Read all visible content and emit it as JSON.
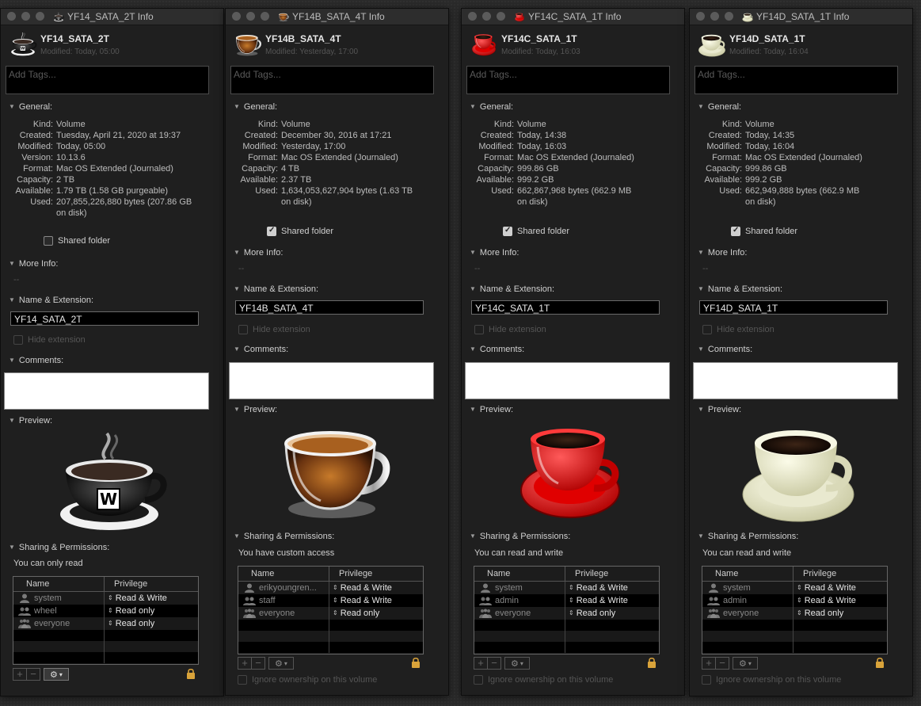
{
  "colors": {
    "window_bg": "#1f1f1f",
    "titlebar": "#2d2d2d",
    "lock_gold": "#d9a33a",
    "check_on": "#cfcfcf"
  },
  "windows": [
    {
      "title": "YF14_SATA_2T Info",
      "name": "YF14_SATA_2T",
      "modified": "Modified: Today, 05:00",
      "icon": "black-coffee-cup-w-icon",
      "tags_placeholder": "Add Tags...",
      "general_label": "General:",
      "general": [
        {
          "k": "Kind:",
          "v": "Volume"
        },
        {
          "k": "Created:",
          "v": "Tuesday, April 21, 2020 at 19:37"
        },
        {
          "k": "Modified:",
          "v": "Today, 05:00"
        },
        {
          "k": "Version:",
          "v": "10.13.6"
        },
        {
          "k": "Format:",
          "v": "Mac OS Extended (Journaled)"
        },
        {
          "k": "Capacity:",
          "v": "2 TB"
        },
        {
          "k": "Available:",
          "v": "1.79 TB (1.58 GB purgeable)"
        },
        {
          "k": "Used:",
          "v": "207,855,226,880 bytes (207.86 GB"
        },
        {
          "k": "",
          "v": "on disk)"
        }
      ],
      "shared_folder": "Shared folder",
      "shared_checked": false,
      "more_info": "More Info:",
      "more_info_value": "--",
      "name_ext": "Name & Extension:",
      "name_value": "YF14_SATA_2T",
      "hide_extension": "Hide extension",
      "comments": "Comments:",
      "preview": "Preview:",
      "sharing": "Sharing & Permissions:",
      "access": "You can only read",
      "col_name": "Name",
      "col_priv": "Privilege",
      "perms": [
        {
          "name": "system",
          "priv": "Read & Write",
          "icon": "user-icon"
        },
        {
          "name": "wheel",
          "priv": "Read only",
          "icon": "group-icon"
        },
        {
          "name": "everyone",
          "priv": "Read only",
          "icon": "everyone-icon"
        }
      ],
      "ignore": ""
    },
    {
      "title": "YF14B_SATA_4T Info",
      "name": "YF14B_SATA_4T",
      "modified": "Modified: Yesterday, 17:00",
      "icon": "glass-espresso-cup-icon",
      "tags_placeholder": "Add Tags...",
      "general_label": "General:",
      "general": [
        {
          "k": "Kind:",
          "v": "Volume"
        },
        {
          "k": "Created:",
          "v": "December 30, 2016 at 17:21"
        },
        {
          "k": "Modified:",
          "v": "Yesterday, 17:00"
        },
        {
          "k": "Format:",
          "v": "Mac OS Extended (Journaled)"
        },
        {
          "k": "Capacity:",
          "v": "4 TB"
        },
        {
          "k": "Available:",
          "v": "2.37 TB"
        },
        {
          "k": "Used:",
          "v": "1,634,053,627,904 bytes (1.63 TB"
        },
        {
          "k": "",
          "v": "on disk)"
        }
      ],
      "shared_folder": "Shared folder",
      "shared_checked": true,
      "more_info": "More Info:",
      "more_info_value": "--",
      "name_ext": "Name & Extension:",
      "name_value": "YF14B_SATA_4T",
      "hide_extension": "Hide extension",
      "comments": "Comments:",
      "preview": "Preview:",
      "sharing": "Sharing & Permissions:",
      "access": "You have custom access",
      "col_name": "Name",
      "col_priv": "Privilege",
      "perms": [
        {
          "name": "erikyoungren...",
          "priv": "Read & Write",
          "icon": "user-icon"
        },
        {
          "name": "staff",
          "priv": "Read & Write",
          "icon": "group-icon"
        },
        {
          "name": "everyone",
          "priv": "Read only",
          "icon": "everyone-icon"
        }
      ],
      "ignore": "Ignore ownership on this volume"
    },
    {
      "title": "YF14C_SATA_1T Info",
      "name": "YF14C_SATA_1T",
      "modified": "Modified: Today, 16:03",
      "icon": "red-coffee-cup-icon",
      "tags_placeholder": "Add Tags...",
      "general_label": "General:",
      "general": [
        {
          "k": "Kind:",
          "v": "Volume"
        },
        {
          "k": "Created:",
          "v": "Today, 14:38"
        },
        {
          "k": "Modified:",
          "v": "Today, 16:03"
        },
        {
          "k": "Format:",
          "v": "Mac OS Extended (Journaled)"
        },
        {
          "k": "Capacity:",
          "v": "999.86 GB"
        },
        {
          "k": "Available:",
          "v": "999.2 GB"
        },
        {
          "k": "Used:",
          "v": "662,867,968 bytes (662.9 MB"
        },
        {
          "k": "",
          "v": "on disk)"
        }
      ],
      "shared_folder": "Shared folder",
      "shared_checked": true,
      "more_info": "More Info:",
      "more_info_value": "--",
      "name_ext": "Name & Extension:",
      "name_value": "YF14C_SATA_1T",
      "hide_extension": "Hide extension",
      "comments": "Comments:",
      "preview": "Preview:",
      "sharing": "Sharing & Permissions:",
      "access": "You can read and write",
      "col_name": "Name",
      "col_priv": "Privilege",
      "perms": [
        {
          "name": "system",
          "priv": "Read & Write",
          "icon": "user-icon"
        },
        {
          "name": "admin",
          "priv": "Read & Write",
          "icon": "group-icon"
        },
        {
          "name": "everyone",
          "priv": "Read only",
          "icon": "everyone-icon"
        }
      ],
      "ignore": "Ignore ownership on this volume"
    },
    {
      "title": "YF14D_SATA_1T Info",
      "name": "YF14D_SATA_1T",
      "modified": "Modified: Today, 16:04",
      "icon": "cream-coffee-cup-icon",
      "tags_placeholder": "Add Tags...",
      "general_label": "General:",
      "general": [
        {
          "k": "Kind:",
          "v": "Volume"
        },
        {
          "k": "Created:",
          "v": "Today, 14:35"
        },
        {
          "k": "Modified:",
          "v": "Today, 16:04"
        },
        {
          "k": "Format:",
          "v": "Mac OS Extended (Journaled)"
        },
        {
          "k": "Capacity:",
          "v": "999.86 GB"
        },
        {
          "k": "Available:",
          "v": "999.2 GB"
        },
        {
          "k": "Used:",
          "v": "662,949,888 bytes (662.9 MB"
        },
        {
          "k": "",
          "v": "on disk)"
        }
      ],
      "shared_folder": "Shared folder",
      "shared_checked": true,
      "more_info": "More Info:",
      "more_info_value": "--",
      "name_ext": "Name & Extension:",
      "name_value": "YF14D_SATA_1T",
      "hide_extension": "Hide extension",
      "comments": "Comments:",
      "preview": "Preview:",
      "sharing": "Sharing & Permissions:",
      "access": "You can read and write",
      "col_name": "Name",
      "col_priv": "Privilege",
      "perms": [
        {
          "name": "system",
          "priv": "Read & Write",
          "icon": "user-icon"
        },
        {
          "name": "admin",
          "priv": "Read & Write",
          "icon": "group-icon"
        },
        {
          "name": "everyone",
          "priv": "Read only",
          "icon": "everyone-icon"
        }
      ],
      "ignore": "Ignore ownership on this volume"
    }
  ]
}
